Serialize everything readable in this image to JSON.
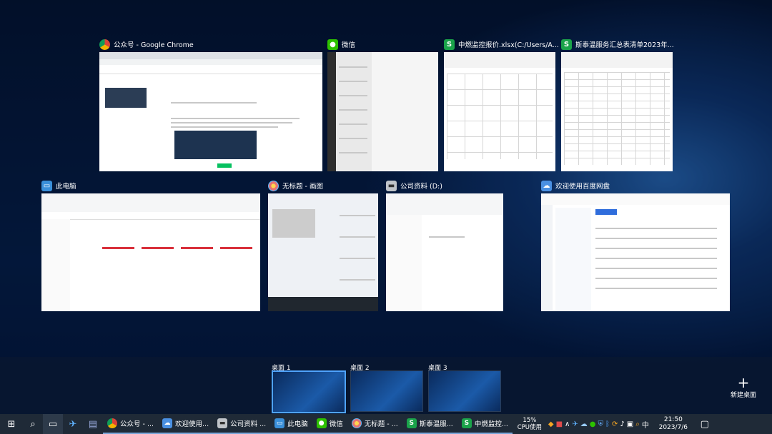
{
  "windows": [
    {
      "title": "公众号 - Google Chrome",
      "icon": "chrome-icon"
    },
    {
      "title": "微信",
      "icon": "wechat-icon"
    },
    {
      "title": "中燃监控报价.xlsx(C:/Users/A...",
      "icon": "wps-sheet-icon"
    },
    {
      "title": "斯泰温服务汇总表清单2023年...",
      "icon": "wps-sheet-icon"
    },
    {
      "title": "此电脑",
      "icon": "computer-icon"
    },
    {
      "title": "无标题 - 画图",
      "icon": "paint-icon"
    },
    {
      "title": "公司资料 (D:)",
      "icon": "drive-icon"
    },
    {
      "title": "欢迎使用百度网盘",
      "icon": "baidu-netdisk-icon"
    }
  ],
  "desktops": [
    {
      "label": "桌面 1"
    },
    {
      "label": "桌面 2"
    },
    {
      "label": "桌面 3"
    }
  ],
  "new_desktop": {
    "plus": "+",
    "label": "新建桌面"
  },
  "taskbar": {
    "apps": [
      {
        "label": "公众号 - ...",
        "icon": "chrome-icon"
      },
      {
        "label": "欢迎使用...",
        "icon": "baidu-netdisk-icon"
      },
      {
        "label": "公司资料 ...",
        "icon": "drive-icon"
      },
      {
        "label": "此电脑",
        "icon": "computer-icon"
      },
      {
        "label": "微信",
        "icon": "wechat-icon"
      },
      {
        "label": "无标题 - ...",
        "icon": "paint-icon"
      },
      {
        "label": "斯泰温服...",
        "icon": "wps-sheet-icon"
      },
      {
        "label": "中燃监控...",
        "icon": "wps-sheet-icon"
      }
    ],
    "cpu_percent": "15%",
    "cpu_label": "CPU使用",
    "ime": "中",
    "time": "21:50",
    "date": "2023/7/6"
  },
  "colors": {
    "accent": "#4fa3ff",
    "wps_green": "#1aa34a",
    "wechat_green": "#2dc100",
    "taskbar": "#1f2a37"
  }
}
